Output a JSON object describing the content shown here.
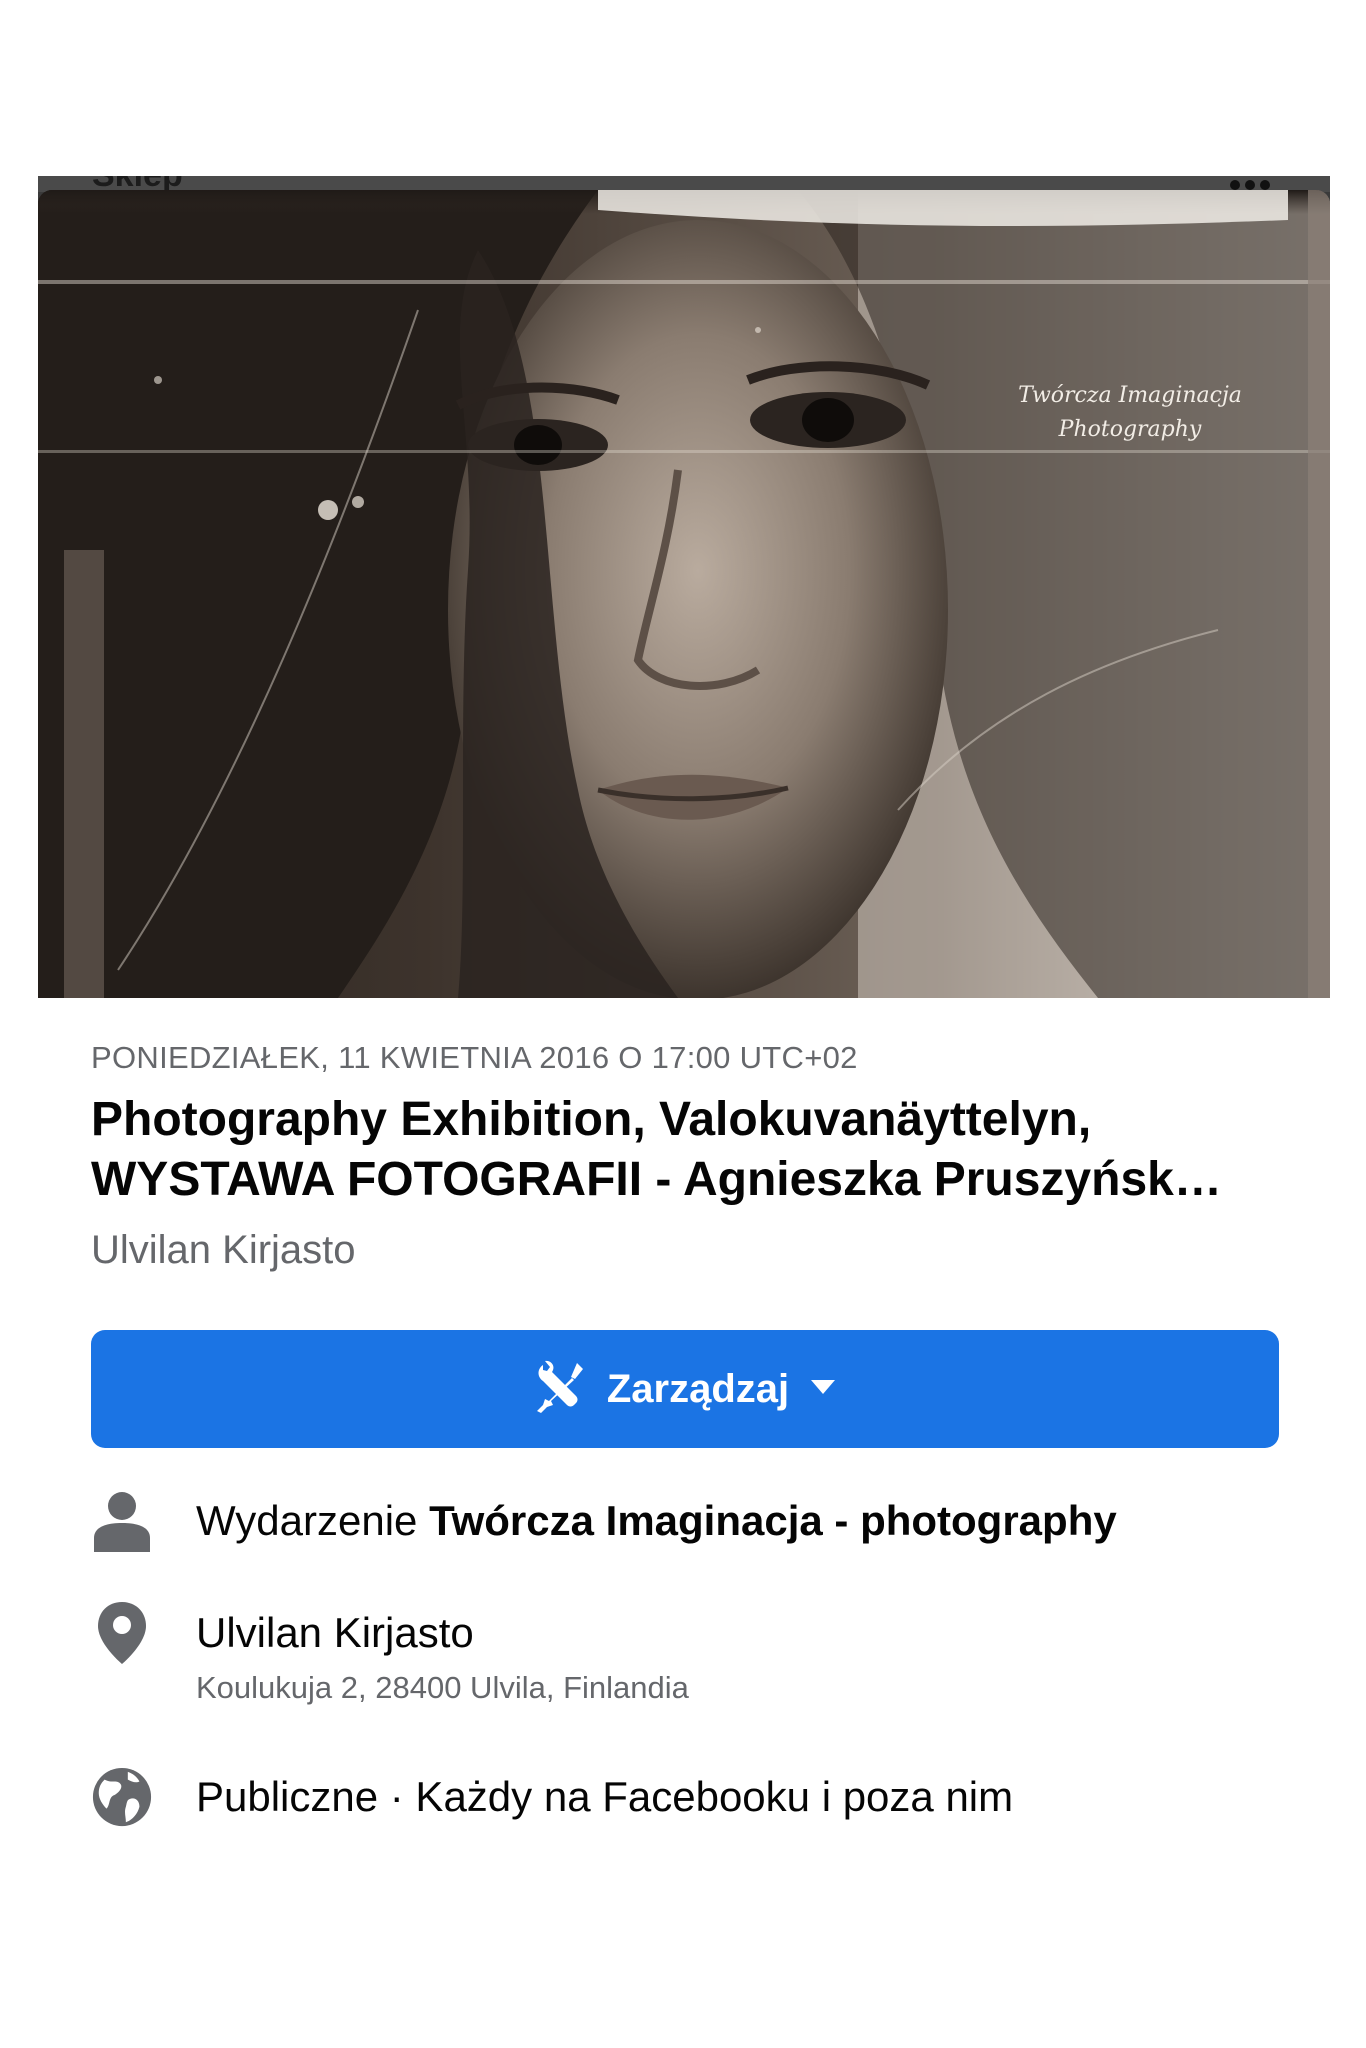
{
  "cover": {
    "topbar_text": "Sklep",
    "watermark_line1": "Twórcza Imaginacja",
    "watermark_line2": "Photography"
  },
  "event": {
    "date": "PONIEDZIAŁEK, 11 KWIETNIA 2016 O 17:00 UTC+02",
    "title_line1": "Photography Exhibition,  Valokuvanäyttelyn,",
    "title_line2": "WYSTAWA FOTOGRAFII - Agnieszka Pruszyńsk…",
    "host": "Ulvilan Kirjasto"
  },
  "manage_button": {
    "label": "Zarządzaj",
    "icon": "tools-icon",
    "color": "#1b74e4"
  },
  "details": {
    "organizer_prefix": "Wydarzenie",
    "organizer_name": "Twórcza Imaginacja  -  photography",
    "location_name": "Ulvilan Kirjasto",
    "location_address": "Koulukuja 2, 28400 Ulvila, Finlandia",
    "privacy": "Publiczne · Każdy na Facebooku i poza nim"
  }
}
